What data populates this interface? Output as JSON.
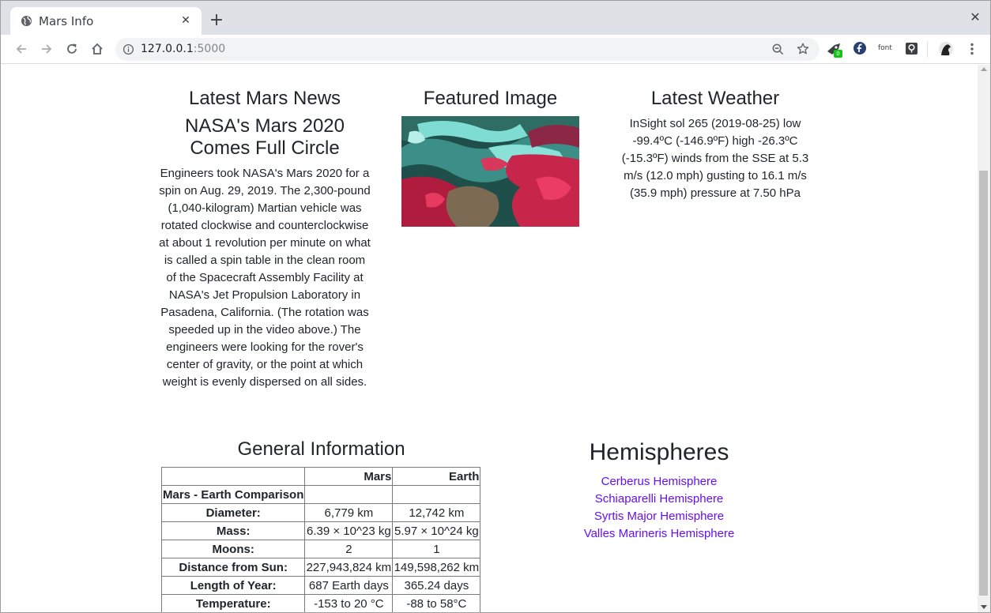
{
  "browser": {
    "tab_title": "Mars Info",
    "url_host": "127.0.0.1",
    "url_port": ":5000",
    "extension_badge": "0",
    "font_extension_label": "font"
  },
  "news": {
    "section_title": "Latest Mars News",
    "title": "NASA's Mars 2020 Comes Full Circle",
    "paragraph": "Engineers took NASA's Mars 2020 for a spin on Aug. 29, 2019. The 2,300-pound (1,040-kilogram) Martian vehicle was rotated clockwise and counterclockwise at about 1 revolution per minute on what is called a spin table in the clean room of the Spacecraft Assembly Facility at NASA's Jet Propulsion Laboratory in Pasadena, California. (The rotation was speeded up in the video above.) The engineers were looking for the rover's center of gravity, or the point at which weight is evenly dispersed on all sides."
  },
  "featured": {
    "section_title": "Featured Image"
  },
  "weather": {
    "section_title": "Latest Weather",
    "text": "InSight sol 265 (2019-08-25) low -99.4ºC (-146.9ºF) high -26.3ºC (-15.3ºF) winds from the SSE at 5.3 m/s (12.0 mph) gusting to 16.1 m/s (35.9 mph) pressure at 7.50 hPa"
  },
  "facts": {
    "section_title": "General Information",
    "headers": [
      "",
      "Mars",
      "Earth"
    ],
    "index_header": "Mars - Earth Comparison",
    "rows": [
      [
        "Diameter:",
        "6,779 km",
        "12,742 km"
      ],
      [
        "Mass:",
        "6.39 × 10^23 kg",
        "5.97 × 10^24 kg"
      ],
      [
        "Moons:",
        "2",
        "1"
      ],
      [
        "Distance from Sun:",
        "227,943,824 km",
        "149,598,262 km"
      ],
      [
        "Length of Year:",
        "687 Earth days",
        "365.24 days"
      ],
      [
        "Temperature:",
        "-153 to 20 °C",
        "-88 to 58°C"
      ]
    ]
  },
  "hemispheres": {
    "section_title": "Hemispheres",
    "links": [
      "Cerberus Hemisphere",
      "Schiaparelli Hemisphere",
      "Syrtis Major Hemisphere",
      "Valles Marineris Hemisphere"
    ]
  },
  "colors": {
    "link": "#6610f2",
    "chrome_tabstrip": "#dee1e6",
    "omnibox": "#f1f3f4"
  }
}
